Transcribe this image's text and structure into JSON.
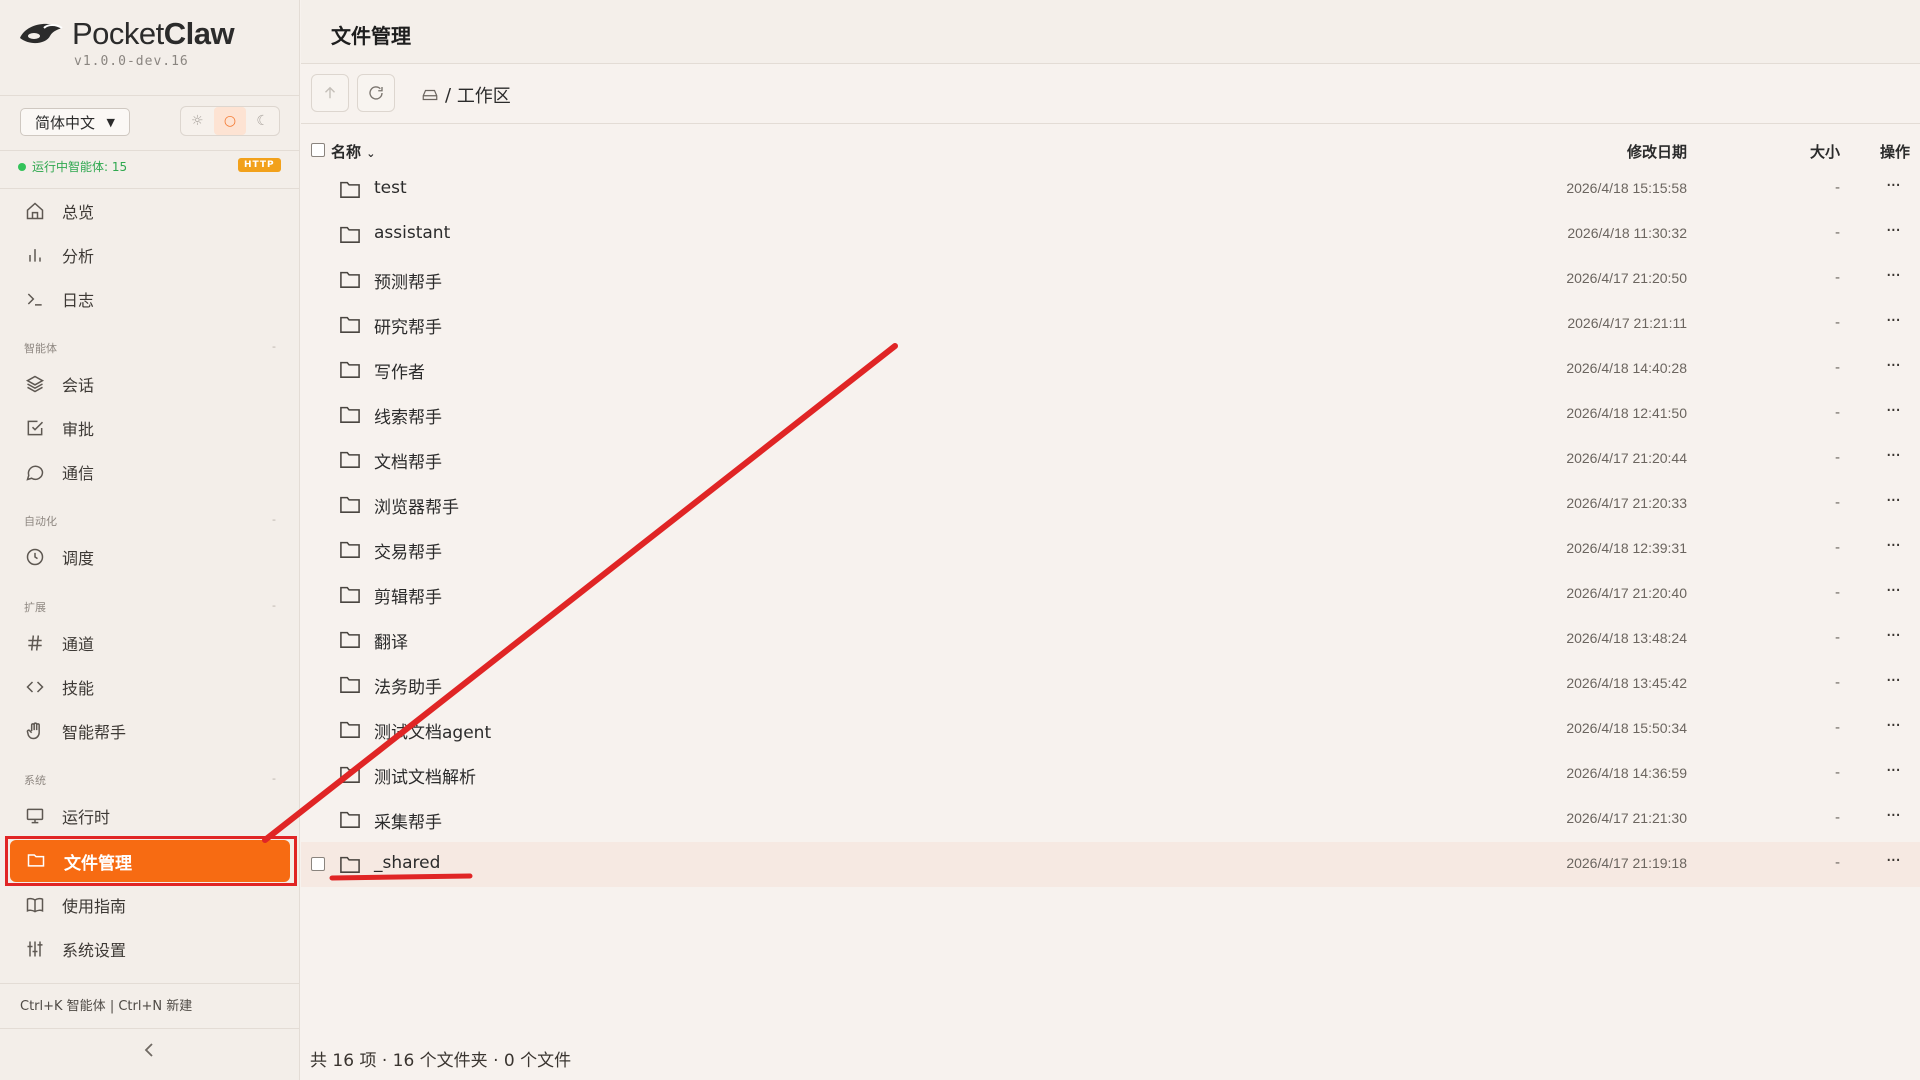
{
  "app": {
    "name_light": "Pocket",
    "name_bold": "Claw",
    "version": "v1.0.0-dev.16"
  },
  "language": "简体中文",
  "theme_buttons": [
    "☼",
    "○",
    "☾"
  ],
  "status": {
    "text": "运行中智能体: 15",
    "badge": "HTTP"
  },
  "nav": {
    "top": [
      {
        "label": "总览",
        "icon": "home-icon"
      },
      {
        "label": "分析",
        "icon": "bar-chart-icon"
      },
      {
        "label": "日志",
        "icon": "terminal-icon"
      }
    ],
    "sections": [
      {
        "title": "智能体",
        "toggle": "-"
      },
      {
        "title": "自动化",
        "toggle": "-"
      },
      {
        "title": "扩展",
        "toggle": "-"
      },
      {
        "title": "系统",
        "toggle": "-"
      }
    ],
    "agents": [
      {
        "label": "会话",
        "icon": "layers-icon"
      },
      {
        "label": "审批",
        "icon": "check-square-icon"
      },
      {
        "label": "通信",
        "icon": "message-circle-icon"
      }
    ],
    "automation": [
      {
        "label": "调度",
        "icon": "clock-icon"
      }
    ],
    "extensions": [
      {
        "label": "通道",
        "icon": "hash-icon"
      },
      {
        "label": "技能",
        "icon": "code-icon"
      },
      {
        "label": "智能帮手",
        "icon": "hand-icon"
      }
    ],
    "system": [
      {
        "label": "运行时",
        "icon": "monitor-icon"
      },
      {
        "label": "文件管理",
        "icon": "folder-icon",
        "active": true
      },
      {
        "label": "使用指南",
        "icon": "book-icon"
      },
      {
        "label": "系统设置",
        "icon": "sliders-icon"
      }
    ]
  },
  "shortcut_hint": "Ctrl+K 智能体 | Ctrl+N 新建",
  "header": {
    "title": "文件管理"
  },
  "breadcrumb": {
    "separator": "/",
    "current": "工作区"
  },
  "table": {
    "columns": {
      "name": "名称",
      "modified": "修改日期",
      "size": "大小",
      "actions": "操作"
    },
    "rows": [
      {
        "name": "test",
        "modified": "2026/4/18 15:15:58",
        "size": "-"
      },
      {
        "name": "assistant",
        "modified": "2026/4/18 11:30:32",
        "size": "-"
      },
      {
        "name": "预测帮手",
        "modified": "2026/4/17 21:20:50",
        "size": "-"
      },
      {
        "name": "研究帮手",
        "modified": "2026/4/17 21:21:11",
        "size": "-"
      },
      {
        "name": "写作者",
        "modified": "2026/4/18 14:40:28",
        "size": "-"
      },
      {
        "name": "线索帮手",
        "modified": "2026/4/18 12:41:50",
        "size": "-"
      },
      {
        "name": "文档帮手",
        "modified": "2026/4/17 21:20:44",
        "size": "-"
      },
      {
        "name": "浏览器帮手",
        "modified": "2026/4/17 21:20:33",
        "size": "-"
      },
      {
        "name": "交易帮手",
        "modified": "2026/4/18 12:39:31",
        "size": "-"
      },
      {
        "name": "剪辑帮手",
        "modified": "2026/4/17 21:20:40",
        "size": "-"
      },
      {
        "name": "翻译",
        "modified": "2026/4/18 13:48:24",
        "size": "-"
      },
      {
        "name": "法务助手",
        "modified": "2026/4/18 13:45:42",
        "size": "-"
      },
      {
        "name": "测试文档agent",
        "modified": "2026/4/18 15:50:34",
        "size": "-"
      },
      {
        "name": "测试文档解析",
        "modified": "2026/4/18 14:36:59",
        "size": "-"
      },
      {
        "name": "采集帮手",
        "modified": "2026/4/17 21:21:30",
        "size": "-"
      },
      {
        "name": "_shared",
        "modified": "2026/4/17 21:19:18",
        "size": "-",
        "highlighted": true
      }
    ],
    "more_glyph": "···"
  },
  "footer": {
    "summary": "共 16 项 · 16 个文件夹 · 0 个文件"
  },
  "colors": {
    "accent": "#f76b12",
    "annotation": "#e02525",
    "status_green": "#2fa84f",
    "badge": "#f2a11b"
  }
}
